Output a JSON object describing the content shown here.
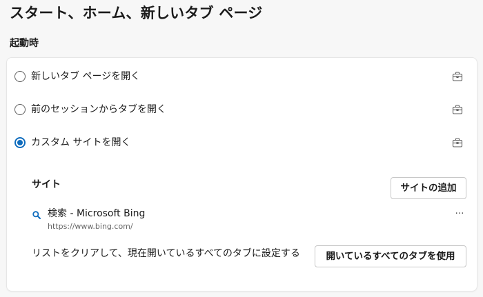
{
  "page": {
    "title": "スタート、ホーム、新しいタブ ページ"
  },
  "startup": {
    "heading": "起動時",
    "options": [
      {
        "label": "新しいタブ ページを開く",
        "checked": false
      },
      {
        "label": "前のセッションからタブを開く",
        "checked": false
      },
      {
        "label": "カスタム サイトを開く",
        "checked": true
      }
    ],
    "policy_icon": "briefcase-icon",
    "accent_color": "#0f6cbd"
  },
  "sites": {
    "heading": "サイト",
    "add_button_label": "サイトの追加",
    "items": [
      {
        "icon": "search-icon",
        "title": "検索 - Microsoft Bing",
        "url": "https://www.bing.com/",
        "more_label": "…"
      }
    ],
    "clear_text": "リストをクリアして、現在開いているすべてのタブに設定する",
    "use_all_tabs_label": "開いているすべてのタブを使用"
  }
}
